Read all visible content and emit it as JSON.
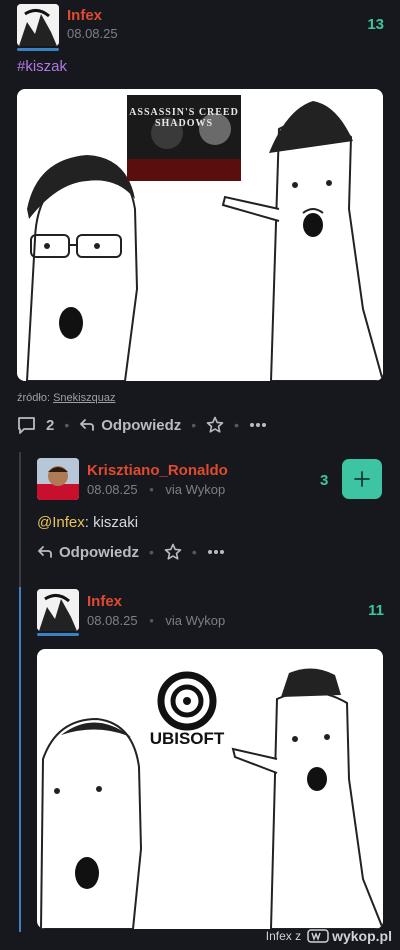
{
  "post": {
    "author": "Infex",
    "date": "08.08.25",
    "score": "13",
    "tag": "#kiszak",
    "image_caption": "ASSASSIN'S CREED SHADOWS",
    "source_label": "źródło:",
    "source_link": "Snekiszquaz",
    "comments_count": "2",
    "reply_label": "Odpowiedz"
  },
  "comment1": {
    "author": "Krisztiano_Ronaldo",
    "date": "08.08.25",
    "via": "via Wykop",
    "score": "3",
    "mention": "@Infex",
    "text": ": kiszaki",
    "reply_label": "Odpowiedz"
  },
  "comment2": {
    "author": "Infex",
    "date": "08.08.25",
    "via": "via Wykop",
    "score": "11",
    "image_logo_text": "UBISOFT"
  },
  "footer": {
    "text": "Infex z",
    "brand": "wykop.pl"
  },
  "colors": {
    "author": "#e04a2f",
    "accent": "#3cc4a3",
    "mention": "#e8c45c"
  }
}
